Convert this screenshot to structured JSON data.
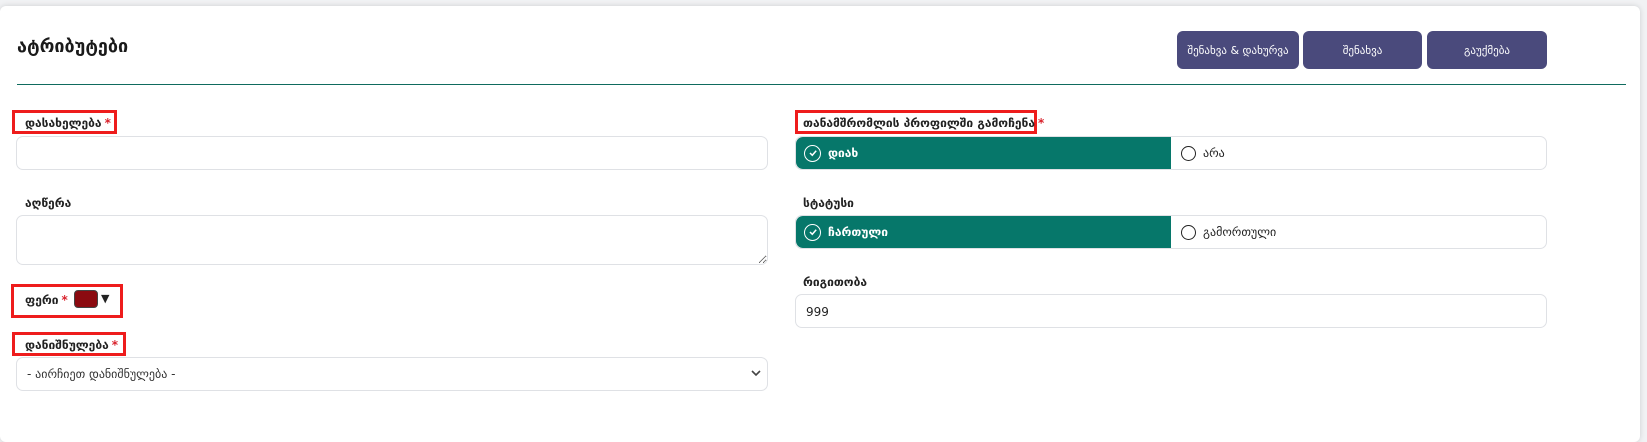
{
  "page": {
    "title": "ატრიბუტები"
  },
  "toolbar": {
    "save_close_label": "შენახვა & დახურვა",
    "save_label": "შენახვა",
    "cancel_label": "გაუქმება"
  },
  "form": {
    "name": {
      "label": "დასახელება",
      "required": "*",
      "value": ""
    },
    "description": {
      "label": "აღწერა",
      "value": ""
    },
    "color": {
      "label": "ფერი",
      "required": "*",
      "value": "#8b0a10"
    },
    "purpose": {
      "label": "დანიშნულება",
      "required": "*",
      "selected": "- აირჩიეთ დანიშნულება -"
    },
    "use_in_profile": {
      "label": "თანამშრომლის პროფილში გამოჩენა",
      "required": "*",
      "option_yes": "დიახ",
      "option_no": "არა",
      "selected": "დიახ"
    },
    "status": {
      "label": "სტატუსი",
      "option_on": "ჩართული",
      "option_off": "გამორთული",
      "selected": "ჩართული"
    },
    "order": {
      "label": "რიგითობა",
      "value": "999"
    }
  },
  "colors": {
    "accent": "#06776a",
    "button": "#4a4a7c",
    "required": "#d9232d",
    "highlight": "#ee1c1c"
  }
}
